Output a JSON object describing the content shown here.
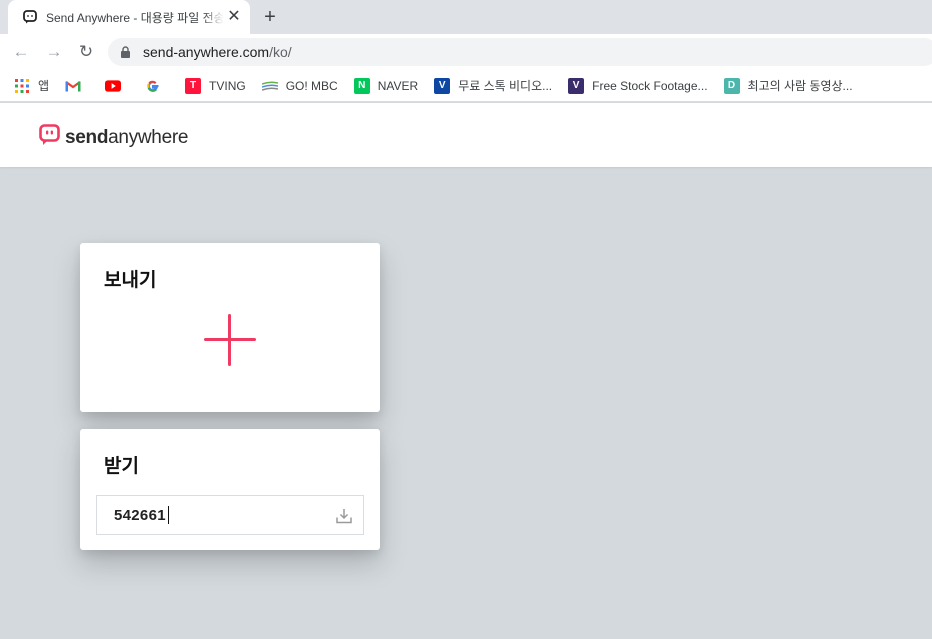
{
  "browser": {
    "tab_title": "Send Anywhere - 대용량 파일 전송",
    "close_glyph": "✕",
    "new_tab_glyph": "+",
    "back_glyph": "←",
    "forward_glyph": "→",
    "reload_glyph": "↻",
    "url_host": "send-anywhere.com",
    "url_path": "/ko/"
  },
  "bookmarks": [
    {
      "label": "앱",
      "icon": "apps-grid-icon"
    },
    {
      "label": "",
      "icon": "gmail-icon"
    },
    {
      "label": "",
      "icon": "youtube-icon"
    },
    {
      "label": "",
      "icon": "google-icon"
    },
    {
      "label": "TVING",
      "icon": "tving-icon"
    },
    {
      "label": "GO! MBC",
      "icon": "mbc-icon"
    },
    {
      "label": "NAVER",
      "icon": "naver-icon"
    },
    {
      "label": "무료 스톡 비디오...",
      "icon": "v-icon"
    },
    {
      "label": "Free Stock Footage...",
      "icon": "v-dark-icon"
    },
    {
      "label": "최고의 사람 동영상...",
      "icon": "d-icon"
    }
  ],
  "site": {
    "logo_bold": "send",
    "logo_light": "anywhere",
    "send_title": "보내기",
    "receive_title": "받기",
    "receive_key": "542661"
  },
  "colors": {
    "brand": "#ef3a61",
    "page_bg": "#d3d9dd"
  }
}
